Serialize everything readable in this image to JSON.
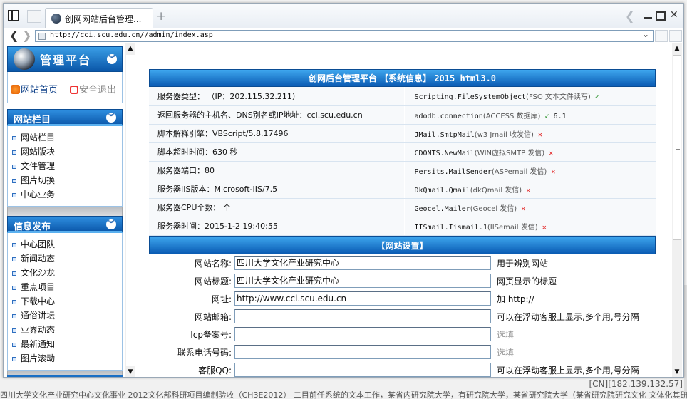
{
  "browser": {
    "tab_title": "创网网站后台管理...",
    "url": "http://cci.scu.edu.cn//admin/index.asp",
    "new_tab_symbol": "+",
    "status_ip": "[CN][182.139.132.57]",
    "backdrop_text": "四川大学文化产业研究中心文化事业               2012文化部科研项目编制验收（CH3E2012） 二目前任系统的文本工作，某省内研究院大学，有研究院大学，某省研究院大学（某省研究院研究文化 文体化其研究大学文化"
  },
  "sidebar": {
    "brand_title": "管理平台",
    "home_link": "网站首页",
    "logout_link": "安全退出",
    "sections": [
      {
        "title": "网站栏目",
        "items": [
          "网站栏目",
          "网站版块",
          "文件管理",
          "图片切换",
          "中心业务"
        ]
      },
      {
        "title": "信息发布",
        "items": [
          "中心团队",
          "新闻动态",
          "文化沙龙",
          "重点项目",
          "下载中心",
          "通俗讲坛",
          "业界动态",
          "最新通知",
          "图片滚动"
        ]
      }
    ]
  },
  "system_info": {
    "title_prefix": "创网后台管理平台 【系统信息】",
    "title_version": "2015 html3.0",
    "left_rows": [
      "服务器类型： （IP：202.115.32.211）",
      "返回服务器的主机名、DNS别名或IP地址：cci.scu.edu.cn",
      "脚本解释引擎：VBScript/5.8.17496",
      "脚本超时时间：630 秒",
      "服务器端口：80",
      "服务器IIS版本：Microsoft-IIS/7.5",
      "服务器CPU个数： 个",
      "服务器时间：2015-1-2 19:40:55"
    ],
    "components": [
      {
        "name": "Scripting.FileSystemObject",
        "desc": "(FSO 文本文件读写)",
        "status": "✓",
        "version": ""
      },
      {
        "name": "adodb.connection",
        "desc": "(ACCESS 数据库)",
        "status": "✓",
        "version": "6.1"
      },
      {
        "name": "JMail.SmtpMail",
        "desc": "(w3 Jmail 收发信)",
        "status": "✕",
        "version": ""
      },
      {
        "name": "CDONTS.NewMail",
        "desc": "(WIN虚拟SMTP 发信)",
        "status": "✕",
        "version": ""
      },
      {
        "name": "Persits.MailSender",
        "desc": "(ASPemail 发信)",
        "status": "✕",
        "version": ""
      },
      {
        "name": "DkQmail.Qmail",
        "desc": "(dkQmail 发信)",
        "status": "✕",
        "version": ""
      },
      {
        "name": "Geocel.Mailer",
        "desc": "(Geocel 发信)",
        "status": "✕",
        "version": ""
      },
      {
        "name": "IISmail.Iismail.1",
        "desc": "(IISemail 发信)",
        "status": "✕",
        "version": ""
      }
    ]
  },
  "site_settings": {
    "title": "【网站设置】",
    "fields": [
      {
        "label": "网站名称:",
        "value": "四川大学文化产业研究中心",
        "hint": "用于辨别网站",
        "hint_gray": false
      },
      {
        "label": "网站标题:",
        "value": "四川大学文化产业研究中心",
        "hint": "网页显示的标题",
        "hint_gray": false
      },
      {
        "label": "网址:",
        "value": "http://www.cci.scu.edu.cn",
        "hint": "加 http://",
        "hint_gray": false
      },
      {
        "label": "网站邮箱:",
        "value": "",
        "hint": "可以在浮动客服上显示,多个用,号分隔",
        "hint_gray": false
      },
      {
        "label": "Icp备案号:",
        "value": "",
        "hint": "选填",
        "hint_gray": true
      },
      {
        "label": "联系电话号码:",
        "value": "",
        "hint": "选填",
        "hint_gray": true
      },
      {
        "label": "客服QQ:",
        "value": "",
        "hint": "可以在浮动客服上显示,多个用,号分隔",
        "hint_gray": false
      }
    ]
  },
  "colors": {
    "header_blue": "#0a5bb3",
    "ok_green": "#1f8c1f",
    "error_red": "#e21b1b"
  }
}
